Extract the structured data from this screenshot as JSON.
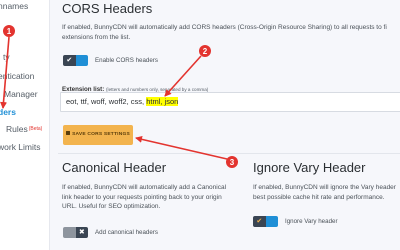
{
  "sidebar": {
    "items": [
      {
        "label": "nnames",
        "active": false
      },
      {
        "label": "",
        "active": false
      },
      {
        "label": "ty",
        "active": false
      },
      {
        "label": "entication",
        "active": false
      },
      {
        "label": "Manager",
        "active": false
      },
      {
        "label": "ders",
        "active": true
      },
      {
        "label": "Rules",
        "active": false,
        "badge": "(Beta)"
      },
      {
        "label": "work Limits",
        "active": false
      }
    ]
  },
  "cors": {
    "title": "CORS Headers",
    "description_lines": [
      "If enabled, BunnyCDN will automatically add CORS headers (Cross-Origin Resource Sharing) to all requests to fi",
      "extensions from the list."
    ],
    "toggle_label": "Enable CORS headers",
    "extension_label": "Extension list:",
    "extension_hint": "(letters and numbers only, separated by a comma)",
    "extension_value_plain": "eot, ttf, woff, woff2, css, ",
    "extension_value_highlighted": "html, json",
    "save_label": "SAVE CORS SETTINGS",
    "save_icon": "floppy-icon"
  },
  "canonical": {
    "title": "Canonical Header",
    "description_lines": [
      "If enabled, BunnyCDN will automatically add a Canonical",
      "link header to your requests pointing back to your origin",
      "URL. Useful for SEO optimization."
    ],
    "toggle_label": "Add canonical headers"
  },
  "vary": {
    "title": "Ignore Vary Header",
    "description_lines": [
      "If enabled, BunnyCDN will ignore the Vary header",
      "best possible cache hit rate and performance."
    ],
    "toggle_label": "Ignore Vary header"
  },
  "annotations": [
    {
      "number": "1"
    },
    {
      "number": "2"
    },
    {
      "number": "3"
    }
  ],
  "colors": {
    "accent_blue": "#1f8fd6",
    "toggle_dark": "#3a4553",
    "toggle_off": "#8e959e",
    "save_button": "#f3b44e",
    "annotation_red": "#e3342f",
    "highlight": "#ffff00"
  }
}
